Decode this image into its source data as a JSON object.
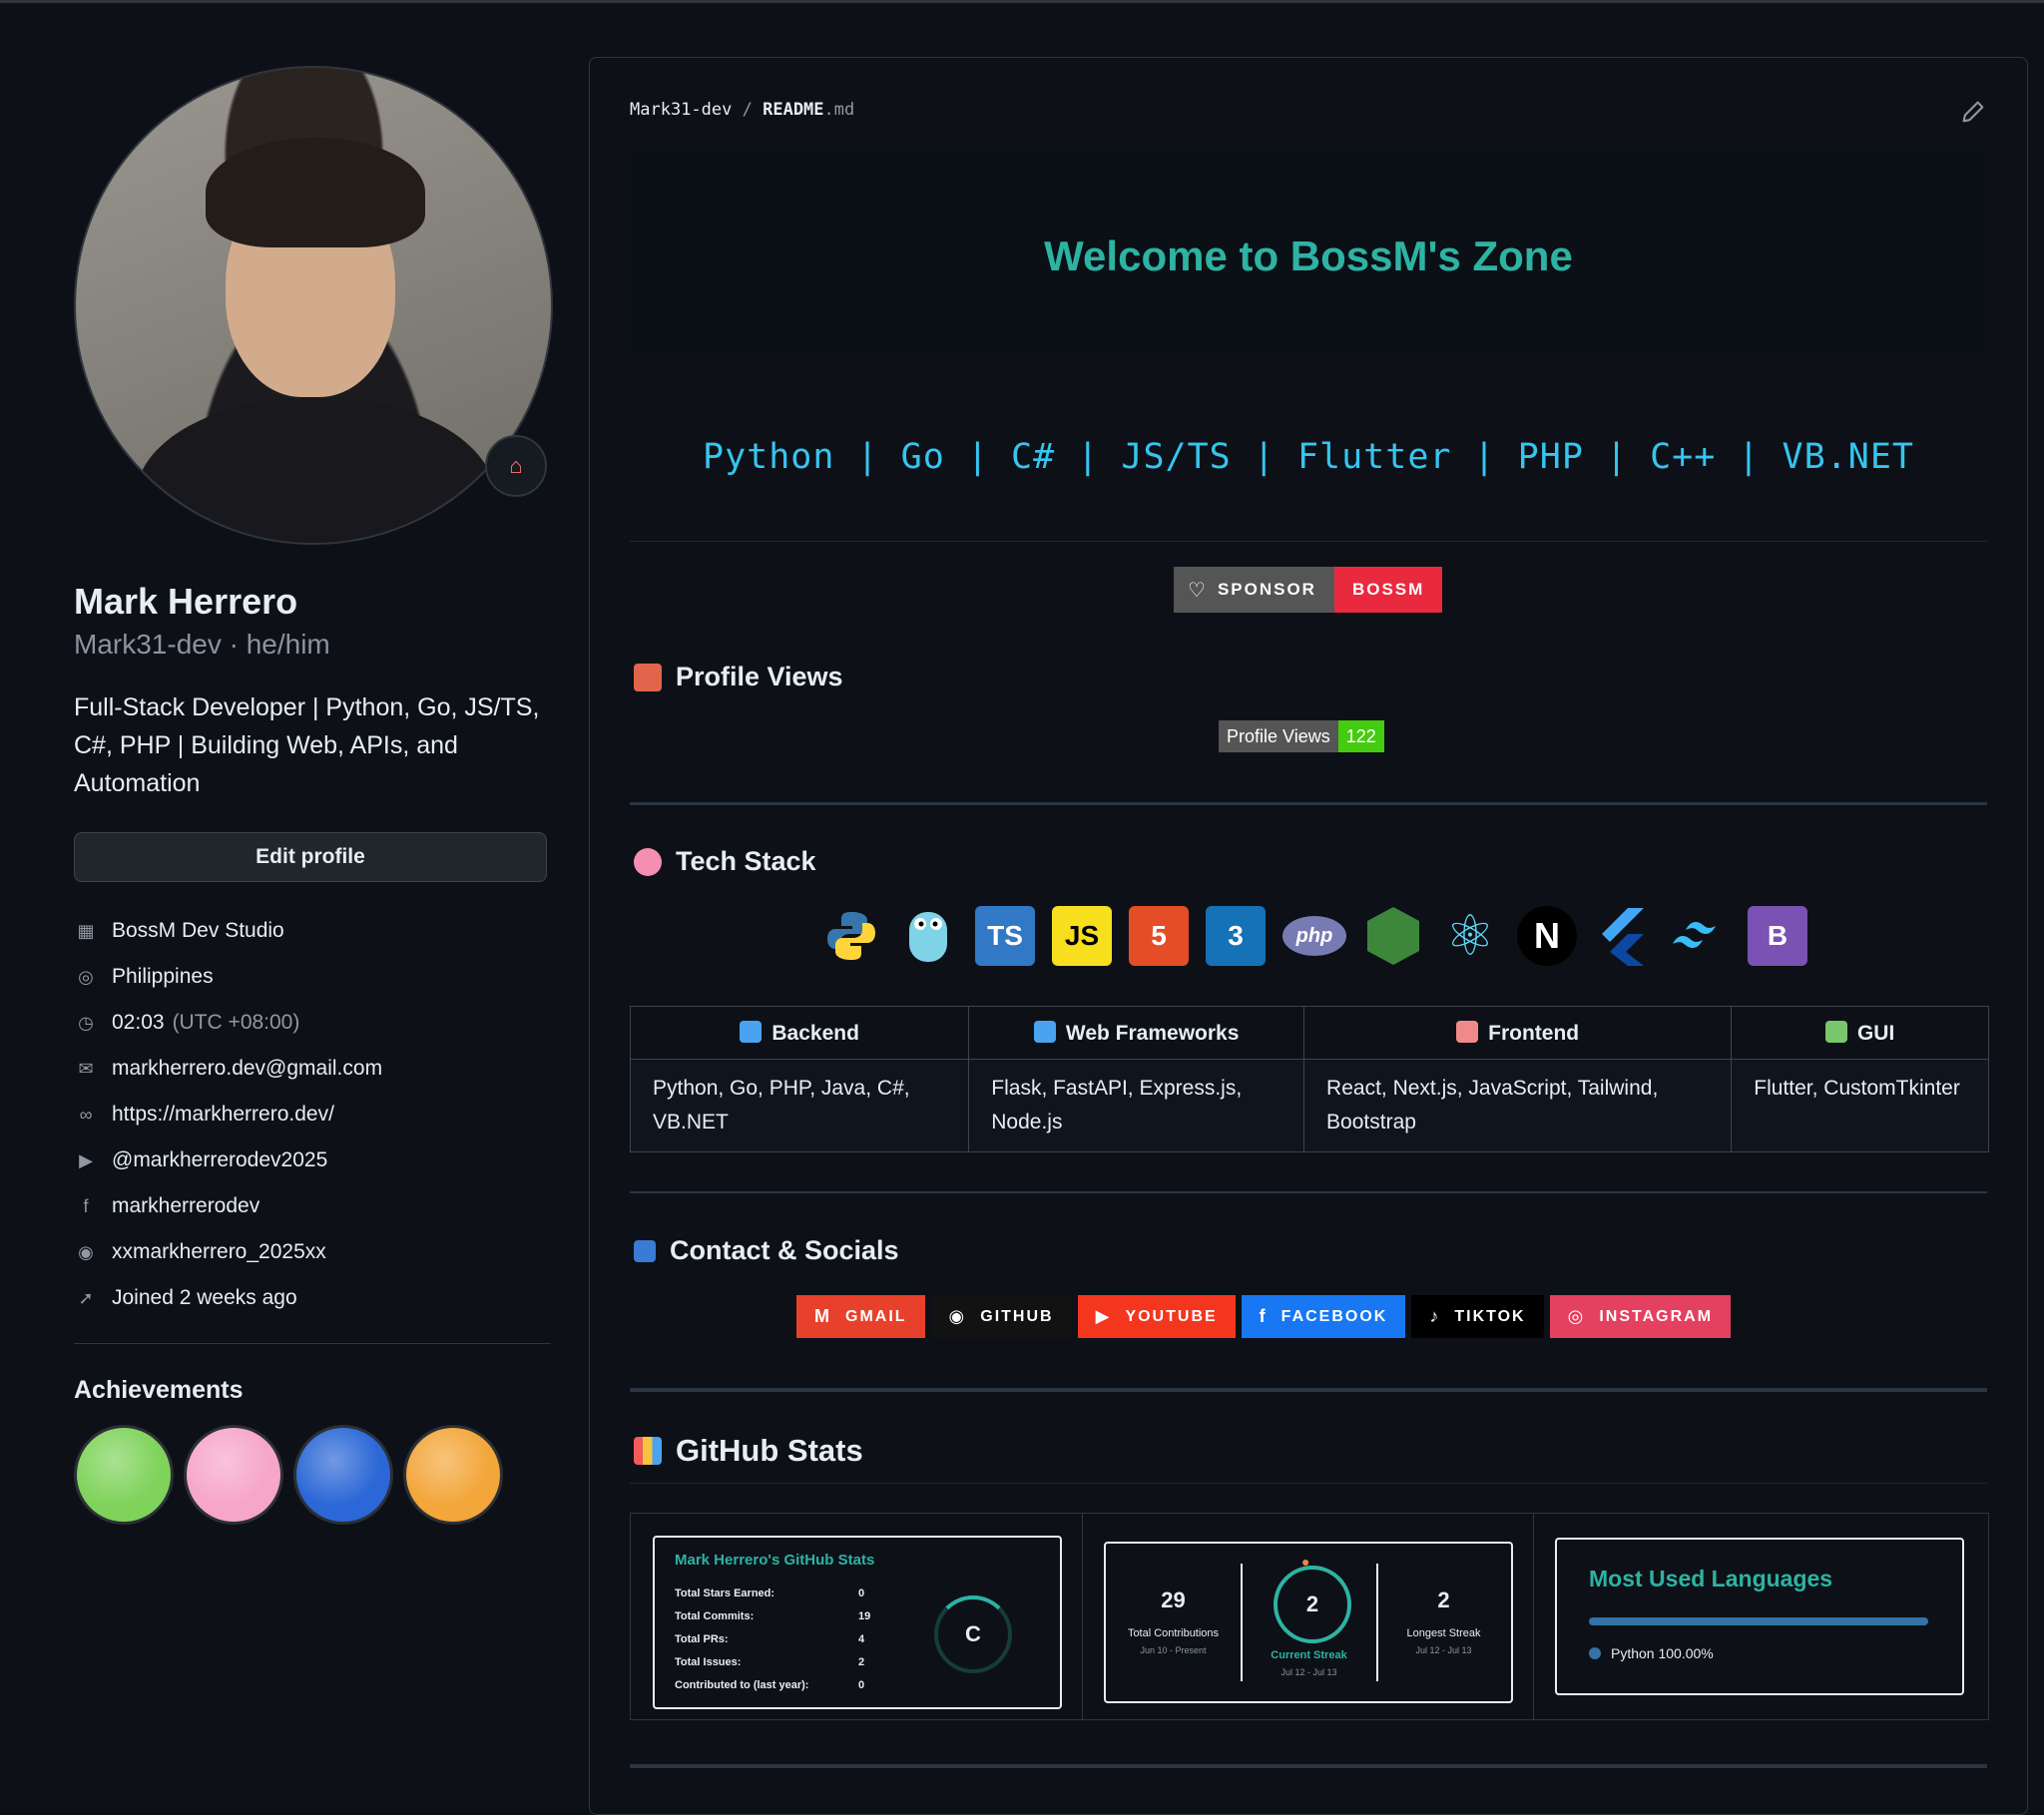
{
  "profile": {
    "name": "Mark Herrero",
    "username": "Mark31-dev · he/him",
    "bio": "Full-Stack Developer | Python, Go, JS/TS, C#, PHP | Building Web, APIs, and Automation",
    "edit_label": "Edit profile",
    "status_icon": "house-icon",
    "info": [
      {
        "icon": "organization-icon",
        "text": "BossM Dev Studio"
      },
      {
        "icon": "location-icon",
        "text": "Philippines"
      },
      {
        "icon": "clock-icon",
        "text": "02:03",
        "muted": "(UTC +08:00)"
      },
      {
        "icon": "mail-icon",
        "text": "markherrero.dev@gmail.com"
      },
      {
        "icon": "link-icon",
        "text": "https://markherrero.dev/"
      },
      {
        "icon": "youtube-icon",
        "text": "@markherrerodev2025"
      },
      {
        "icon": "facebook-icon",
        "text": "markherrerodev"
      },
      {
        "icon": "instagram-icon",
        "text": "xxmarkherrero_2025xx"
      },
      {
        "icon": "rocket-icon",
        "text": "Joined 2 weeks ago"
      }
    ],
    "achievements_title": "Achievements",
    "achievements": [
      {
        "icon": "pair-extraordinaire-icon",
        "color": "#7fd35b"
      },
      {
        "icon": "yolo-icon",
        "color": "#f6a6c8"
      },
      {
        "icon": "pull-shark-icon",
        "color": "#2b67d6"
      },
      {
        "icon": "quickdraw-icon",
        "color": "#f3a63a"
      }
    ]
  },
  "readme": {
    "path_owner": "Mark31-dev",
    "path_sep": "/",
    "path_file": "README",
    "path_ext": ".md",
    "welcome": "Welcome to BossM's Zone",
    "typing": "Python | Go | C# | JS/TS | Flutter | PHP | C++ | VB.NET",
    "sponsor": {
      "left": "SPONSOR",
      "right": "BOSSM"
    },
    "profile_views_title": "Profile Views",
    "profile_views_badge": {
      "label": "Profile Views",
      "count": "122"
    },
    "tech_stack_title": "Tech Stack",
    "tech_icons": [
      {
        "name": "python-icon",
        "glyph": "",
        "bg": "transparent",
        "fg": "#3776ab"
      },
      {
        "name": "go-gopher-icon",
        "glyph": "",
        "bg": "transparent",
        "fg": "#7fd3e6"
      },
      {
        "name": "typescript-icon",
        "glyph": "TS",
        "bg": "#3178c6",
        "fg": "#ffffff"
      },
      {
        "name": "javascript-icon",
        "glyph": "JS",
        "bg": "#f7df1e",
        "fg": "#000000"
      },
      {
        "name": "html5-icon",
        "glyph": "5",
        "bg": "#e44d26",
        "fg": "#ffffff"
      },
      {
        "name": "css3-icon",
        "glyph": "3",
        "bg": "#1572b6",
        "fg": "#ffffff"
      },
      {
        "name": "php-icon",
        "glyph": "php",
        "bg": "#777bb3",
        "fg": "#ffffff"
      },
      {
        "name": "nodejs-icon",
        "glyph": "",
        "bg": "#3c873a",
        "fg": "#ffffff"
      },
      {
        "name": "react-icon",
        "glyph": "⚛",
        "bg": "transparent",
        "fg": "#61dafb"
      },
      {
        "name": "nextjs-icon",
        "glyph": "N",
        "bg": "#000000",
        "fg": "#ffffff"
      },
      {
        "name": "flutter-icon",
        "glyph": "",
        "bg": "transparent",
        "fg": "#42a5f5"
      },
      {
        "name": "tailwind-icon",
        "glyph": "≈",
        "bg": "transparent",
        "fg": "#38bdf8"
      },
      {
        "name": "bootstrap-icon",
        "glyph": "B",
        "bg": "#7952b3",
        "fg": "#ffffff"
      }
    ],
    "stack_table": {
      "headers": [
        {
          "label": "Backend",
          "icon": "laptop-icon",
          "color": "#4aa3f0"
        },
        {
          "label": "Web Frameworks",
          "icon": "globe-icon",
          "color": "#4aa3f0"
        },
        {
          "label": "Frontend",
          "icon": "palette-icon",
          "color": "#f08a8a"
        },
        {
          "label": "GUI",
          "icon": "picture-icon",
          "color": "#7ac66a"
        }
      ],
      "cells": [
        "Python, Go, PHP, Java, C#, VB.NET",
        "Flask, FastAPI, Express.js, Node.js",
        "React, Next.js, JavaScript, Tailwind, Bootstrap",
        "Flutter, CustomTkinter"
      ]
    },
    "contact_title": "Contact & Socials",
    "socials": [
      {
        "label": "GMAIL",
        "glyph": "M",
        "bg": "#e8412b",
        "icon": "gmail-icon"
      },
      {
        "label": "GITHUB",
        "glyph": "◉",
        "bg": "#121212",
        "icon": "github-icon"
      },
      {
        "label": "YOUTUBE",
        "glyph": "▶",
        "bg": "#f4361f",
        "icon": "youtube-icon"
      },
      {
        "label": "FACEBOOK",
        "glyph": "f",
        "bg": "#1877f2",
        "icon": "facebook-icon"
      },
      {
        "label": "TIKTOK",
        "glyph": "♪",
        "bg": "#000000",
        "icon": "tiktok-icon"
      },
      {
        "label": "INSTAGRAM",
        "glyph": "◎",
        "bg": "#e4405f",
        "icon": "instagram-icon"
      }
    ],
    "github_stats_title": "GitHub Stats",
    "stats_card": {
      "title": "Mark Herrero's GitHub Stats",
      "rows": [
        {
          "k": "Total Stars Earned:",
          "v": "0"
        },
        {
          "k": "Total Commits:",
          "v": "19"
        },
        {
          "k": "Total PRs:",
          "v": "4"
        },
        {
          "k": "Total Issues:",
          "v": "2"
        },
        {
          "k": "Contributed to (last year):",
          "v": "0"
        }
      ],
      "grade": "C"
    },
    "streak_card": {
      "total": "29",
      "total_label": "Total Contributions",
      "total_range": "Jun 10 - Present",
      "current": "2",
      "current_label": "Current Streak",
      "current_range": "Jul 12 - Jul 13",
      "longest": "2",
      "longest_label": "Longest Streak",
      "longest_range": "Jul 12 - Jul 13"
    },
    "languages_card": {
      "title": "Most Used Languages",
      "entry": "Python 100.00%",
      "percent": 100
    }
  }
}
